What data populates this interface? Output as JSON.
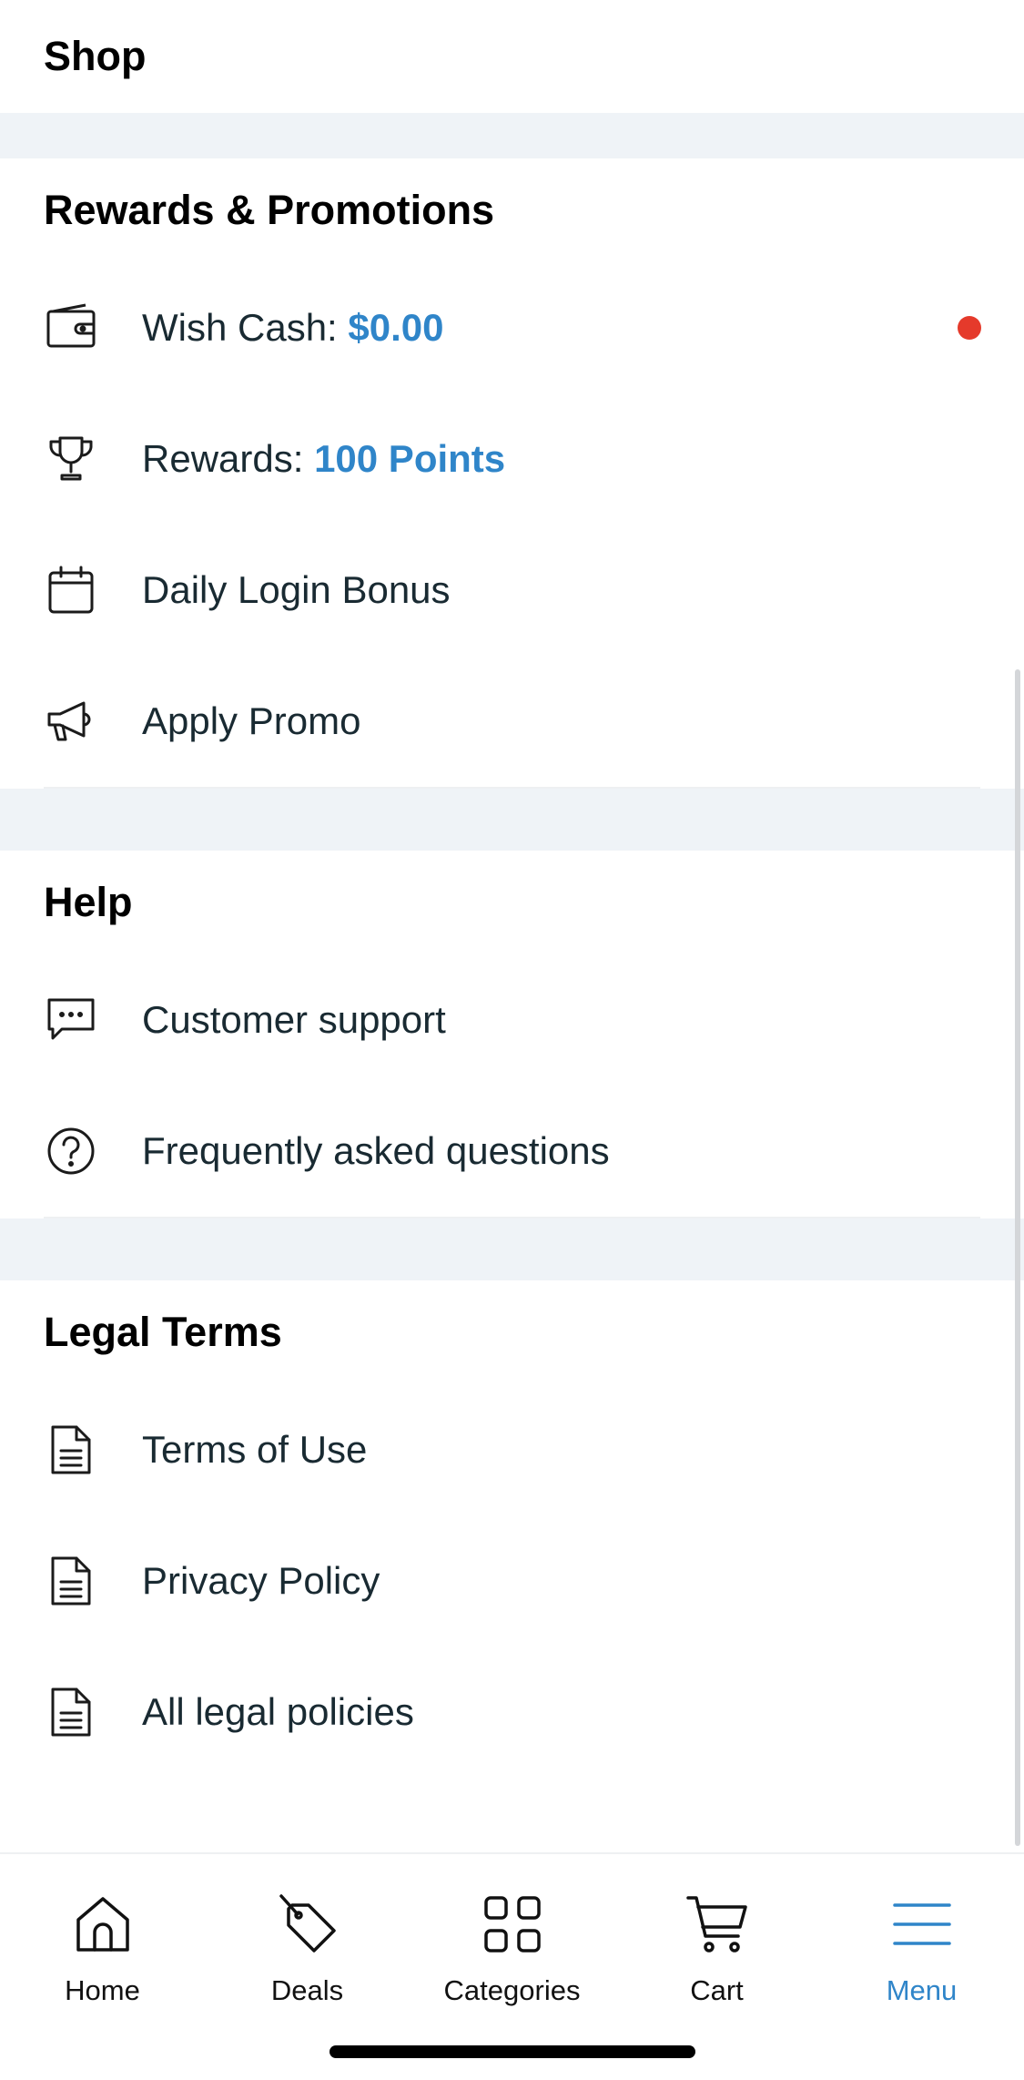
{
  "shop": {
    "title": "Shop"
  },
  "rewards": {
    "title": "Rewards & Promotions",
    "items": [
      {
        "label": "Wish Cash: ",
        "value": "$0.00",
        "icon": "wallet-icon",
        "badge": true
      },
      {
        "label": "Rewards: ",
        "value": "100 Points",
        "icon": "trophy-icon"
      },
      {
        "label": "Daily Login Bonus",
        "icon": "calendar-icon"
      },
      {
        "label": "Apply Promo",
        "icon": "megaphone-icon"
      }
    ]
  },
  "help": {
    "title": "Help",
    "items": [
      {
        "label": "Customer support",
        "icon": "chat-icon"
      },
      {
        "label": "Frequently asked questions",
        "icon": "question-circle-icon"
      }
    ]
  },
  "legal": {
    "title": "Legal Terms",
    "items": [
      {
        "label": "Terms of Use",
        "icon": "document-icon"
      },
      {
        "label": "Privacy Policy",
        "icon": "document-icon"
      },
      {
        "label": "All legal policies",
        "icon": "document-icon"
      }
    ]
  },
  "tabbar": {
    "active": "Menu",
    "tabs": [
      {
        "label": "Home",
        "icon": "home-icon"
      },
      {
        "label": "Deals",
        "icon": "tag-icon"
      },
      {
        "label": "Categories",
        "icon": "grid-icon"
      },
      {
        "label": "Cart",
        "icon": "cart-icon"
      },
      {
        "label": "Menu",
        "icon": "hamburger-menu-icon"
      }
    ]
  },
  "colors": {
    "accent": "#2f85c9",
    "badge": "#e53a2b",
    "section_gap": "#eff3f7",
    "text": "#192a32"
  }
}
